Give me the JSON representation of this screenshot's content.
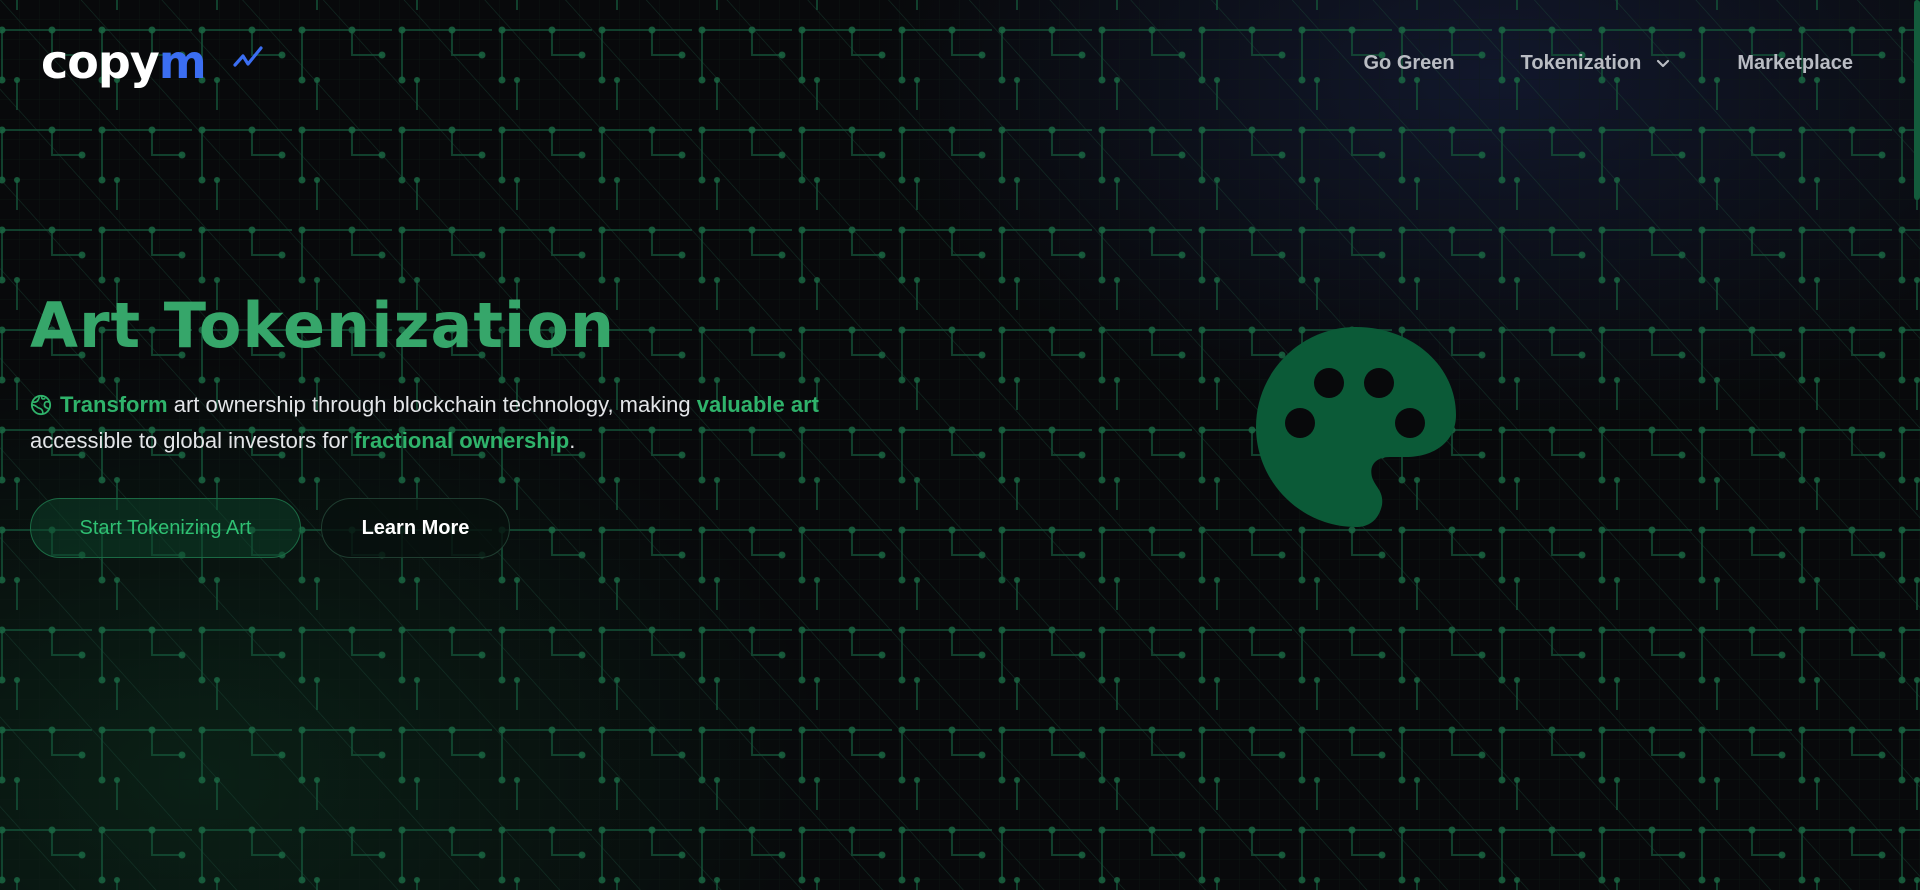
{
  "brand": {
    "logo_main": "copy",
    "logo_accent": "m",
    "accent_color": "#3b6ef2"
  },
  "nav": {
    "items": [
      {
        "label": "Go Green"
      },
      {
        "label": "Tokenization"
      },
      {
        "label": "Marketplace"
      }
    ]
  },
  "hero": {
    "title": "Art Tokenization",
    "desc": {
      "hl1": "Transform",
      "t1": " art ownership through blockchain technology, making ",
      "hl2": "valuable art",
      "t2": " accessible to global investors for ",
      "hl3": "fractional ownership",
      "t3": "."
    },
    "primary_button": "Start Tokenizing Art",
    "secondary_button": "Learn More",
    "illustration_icon": "palette-icon",
    "title_color": "#36a66a",
    "highlight_color": "#2fb36b"
  }
}
